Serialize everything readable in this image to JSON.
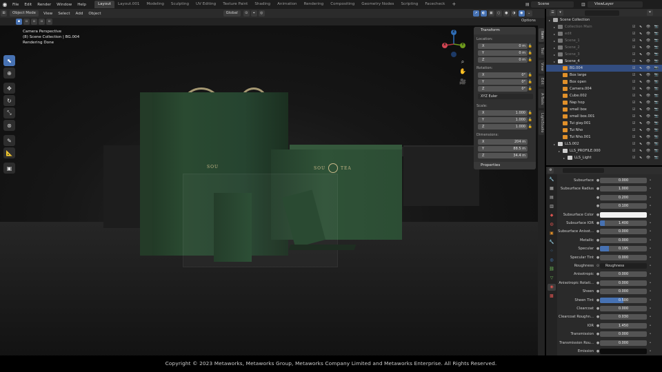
{
  "menubar": {
    "items": [
      "File",
      "Edit",
      "Render",
      "Window",
      "Help"
    ],
    "tabs": [
      "Layout",
      "Layout.001",
      "Modeling",
      "Sculpting",
      "UV Editing",
      "Texture Paint",
      "Shading",
      "Animation",
      "Rendering",
      "Compositing",
      "Geometry Nodes",
      "Scripting",
      "Facecheck"
    ],
    "active_tab": "Layout",
    "scene": "Scene",
    "view_layer": "ViewLayer"
  },
  "viewport_header": {
    "mode": "Object Mode",
    "menus": [
      "View",
      "Select",
      "Add",
      "Object"
    ],
    "orientation": "Global",
    "options": "Options"
  },
  "viewport_info": {
    "line1": "Camera Perspective",
    "line2": "(8) Scene Collection | BG.004",
    "line3": "Rendering Done"
  },
  "scene_text": {
    "brand_left": "SOU",
    "brand_right": "TEA"
  },
  "gizmo": {
    "x": "X",
    "y": "Y",
    "z": "Z"
  },
  "transform": {
    "title": "Transform",
    "location_label": "Location:",
    "location": [
      {
        "axis": "X",
        "value": "0 m"
      },
      {
        "axis": "Y",
        "value": "0 m"
      },
      {
        "axis": "Z",
        "value": "0 m"
      }
    ],
    "rotation_label": "Rotation:",
    "rotation": [
      {
        "axis": "X",
        "value": "0°"
      },
      {
        "axis": "Y",
        "value": "0°"
      },
      {
        "axis": "Z",
        "value": "0°"
      }
    ],
    "rotation_mode": "XYZ Euler",
    "scale_label": "Scale:",
    "scale": [
      {
        "axis": "X",
        "value": "1.000"
      },
      {
        "axis": "Y",
        "value": "1.000"
      },
      {
        "axis": "Z",
        "value": "1.000"
      }
    ],
    "dimensions_label": "Dimensions:",
    "dimensions": [
      {
        "axis": "X",
        "value": "204 m"
      },
      {
        "axis": "Y",
        "value": "88.5 m"
      },
      {
        "axis": "Z",
        "value": "34.4 m"
      }
    ],
    "properties": "Properties"
  },
  "side_tabs": [
    "Item",
    "Tool",
    "View",
    "Edit",
    "A-Tools",
    "LightStudio"
  ],
  "outliner": {
    "rows": [
      {
        "label": "Scene Collection",
        "depth": 0,
        "color": "#aaaaaa",
        "dim": false,
        "sel": false
      },
      {
        "label": "Collection Main",
        "depth": 1,
        "color": "#777777",
        "dim": true,
        "sel": false
      },
      {
        "label": "edit",
        "depth": 1,
        "color": "#777777",
        "dim": true,
        "sel": false
      },
      {
        "label": "Scene_1",
        "depth": 1,
        "color": "#777777",
        "dim": true,
        "sel": false
      },
      {
        "label": "Scene_2",
        "depth": 1,
        "color": "#777777",
        "dim": true,
        "sel": false
      },
      {
        "label": "Scene_3",
        "depth": 1,
        "color": "#777777",
        "dim": true,
        "sel": false
      },
      {
        "label": "Scene_4",
        "depth": 1,
        "color": "#cfcfcf",
        "dim": false,
        "sel": false
      },
      {
        "label": "BG.004",
        "depth": 2,
        "color": "#e0902a",
        "dim": false,
        "sel": true
      },
      {
        "label": "Box large",
        "depth": 2,
        "color": "#e0902a",
        "dim": false,
        "sel": false
      },
      {
        "label": "Box open",
        "depth": 2,
        "color": "#e0902a",
        "dim": false,
        "sel": false
      },
      {
        "label": "Camera.004",
        "depth": 2,
        "color": "#e0902a",
        "dim": false,
        "sel": false
      },
      {
        "label": "Cube.002",
        "depth": 2,
        "color": "#e0902a",
        "dim": false,
        "sel": false
      },
      {
        "label": "Nap hop",
        "depth": 2,
        "color": "#e0902a",
        "dim": false,
        "sel": false
      },
      {
        "label": "small box",
        "depth": 2,
        "color": "#e0902a",
        "dim": false,
        "sel": false
      },
      {
        "label": "small box.001",
        "depth": 2,
        "color": "#e0902a",
        "dim": false,
        "sel": false
      },
      {
        "label": "Tui giay.001",
        "depth": 2,
        "color": "#e0902a",
        "dim": false,
        "sel": false
      },
      {
        "label": "Tui Nho",
        "depth": 2,
        "color": "#e0902a",
        "dim": false,
        "sel": false
      },
      {
        "label": "Tui Nho.001",
        "depth": 2,
        "color": "#e0902a",
        "dim": false,
        "sel": false
      },
      {
        "label": "LLS.002",
        "depth": 1,
        "color": "#cfcfcf",
        "dim": false,
        "sel": false
      },
      {
        "label": "LLS_PROFILE.000",
        "depth": 2,
        "color": "#cfcfcf",
        "dim": false,
        "sel": false
      },
      {
        "label": "LLS_Light",
        "depth": 3,
        "color": "#cfcfcf",
        "dim": false,
        "sel": false
      }
    ]
  },
  "properties": {
    "rows": [
      {
        "label": "Subsurface",
        "value": "0.000",
        "kind": "num",
        "fill": 0
      },
      {
        "label": "Subsurface Radius",
        "value": "1.000",
        "kind": "num",
        "fill": 0
      },
      {
        "label": "",
        "value": "0.200",
        "kind": "num",
        "fill": 0
      },
      {
        "label": "",
        "value": "0.100",
        "kind": "num",
        "fill": 0
      },
      {
        "label": "Subsurface Color",
        "value": "",
        "kind": "white",
        "fill": 0
      },
      {
        "label": "Subsurface IOR",
        "value": "1.400",
        "kind": "num",
        "fill": 0.1
      },
      {
        "label": "Subsurface Anisot...",
        "value": "0.000",
        "kind": "num",
        "fill": 0
      },
      {
        "label": "Metallic",
        "value": "0.000",
        "kind": "num",
        "fill": 0
      },
      {
        "label": "Specular",
        "value": "0.195",
        "kind": "num",
        "fill": 0.195
      },
      {
        "label": "Specular Tint",
        "value": "0.000",
        "kind": "num",
        "fill": 0
      },
      {
        "label": "Roughness",
        "value": "Roughness",
        "kind": "node",
        "fill": 0
      },
      {
        "label": "Anisotropic",
        "value": "0.000",
        "kind": "num",
        "fill": 0
      },
      {
        "label": "Anisotropic Rotati...",
        "value": "0.000",
        "kind": "num",
        "fill": 0
      },
      {
        "label": "Sheen",
        "value": "0.000",
        "kind": "num",
        "fill": 0
      },
      {
        "label": "Sheen Tint",
        "value": "0.500",
        "kind": "num",
        "fill": 0.5
      },
      {
        "label": "Clearcoat",
        "value": "0.000",
        "kind": "num",
        "fill": 0
      },
      {
        "label": "Clearcoat Roughn...",
        "value": "0.030",
        "kind": "num",
        "fill": 0
      },
      {
        "label": "IOR",
        "value": "1.450",
        "kind": "num",
        "fill": 0
      },
      {
        "label": "Transmission",
        "value": "0.000",
        "kind": "num",
        "fill": 0
      },
      {
        "label": "Transmission Rou...",
        "value": "0.000",
        "kind": "num",
        "fill": 0
      },
      {
        "label": "Emission",
        "value": "",
        "kind": "black",
        "fill": 0
      }
    ]
  },
  "footer": {
    "copyright": "Copyright © 2023 Metaworks, Metaworks Group, Metaworks Company Limited and Metaworks Enterprise. All Rights Reserved."
  }
}
